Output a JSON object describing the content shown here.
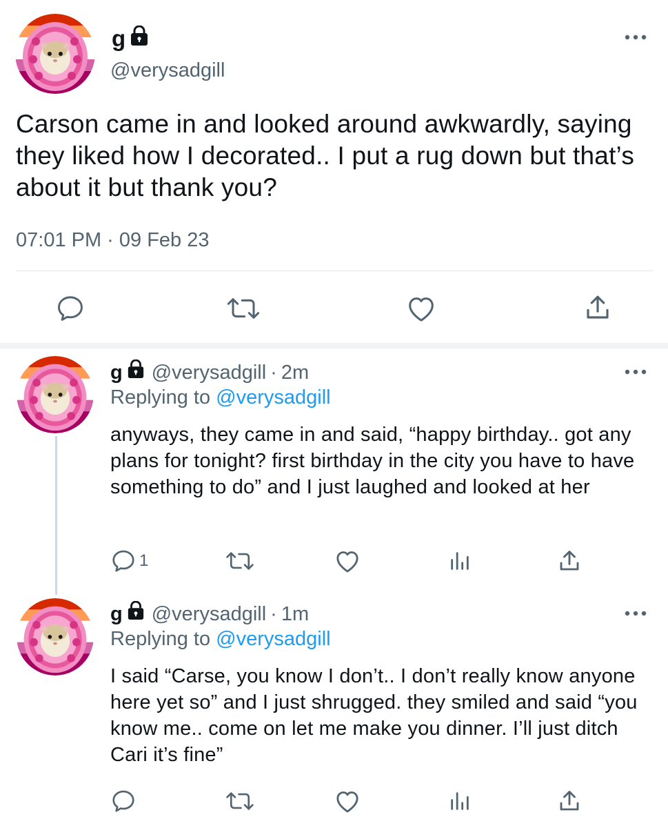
{
  "main_tweet": {
    "display_name": "g",
    "handle": "@verysadgill",
    "text": "Carson came in and looked around awkwardly, saying they liked how I decorated.. I put a rug down but that’s about it but thank you?",
    "timestamp": "07:01 PM · 09 Feb 23"
  },
  "replies": [
    {
      "display_name": "g",
      "handle": "@verysadgill",
      "separator": "·",
      "time_ago": "2m",
      "replying_prefix": "Replying to",
      "replying_to": "@verysadgill",
      "text": "anyways, they came in and said, “happy birthday.. got any plans for tonight? first birthday in the city you have to have something to do” and I just laughed and looked at her",
      "reply_count": "1"
    },
    {
      "display_name": "g",
      "handle": "@verysadgill",
      "separator": "·",
      "time_ago": "1m",
      "replying_prefix": "Replying to",
      "replying_to": "@verysadgill",
      "text": "I said “Carse, you know I don’t.. I don’t really know anyone here yet so” and I just shrugged. they smiled and said “you know me.. come on let me make you dinner. I’ll just ditch Cari it’s fine”",
      "reply_count": ""
    }
  ],
  "icons": {
    "reply": "speech-bubble-icon",
    "retweet": "retweet-icon",
    "like": "heart-icon",
    "analytics": "bar-chart-icon",
    "share": "share-icon",
    "more": "more-dots-icon",
    "protected": "lock-icon"
  },
  "colors": {
    "text": "#0f1419",
    "secondary": "#536471",
    "link": "#1d9bf0",
    "divider": "#e1e4e8"
  }
}
